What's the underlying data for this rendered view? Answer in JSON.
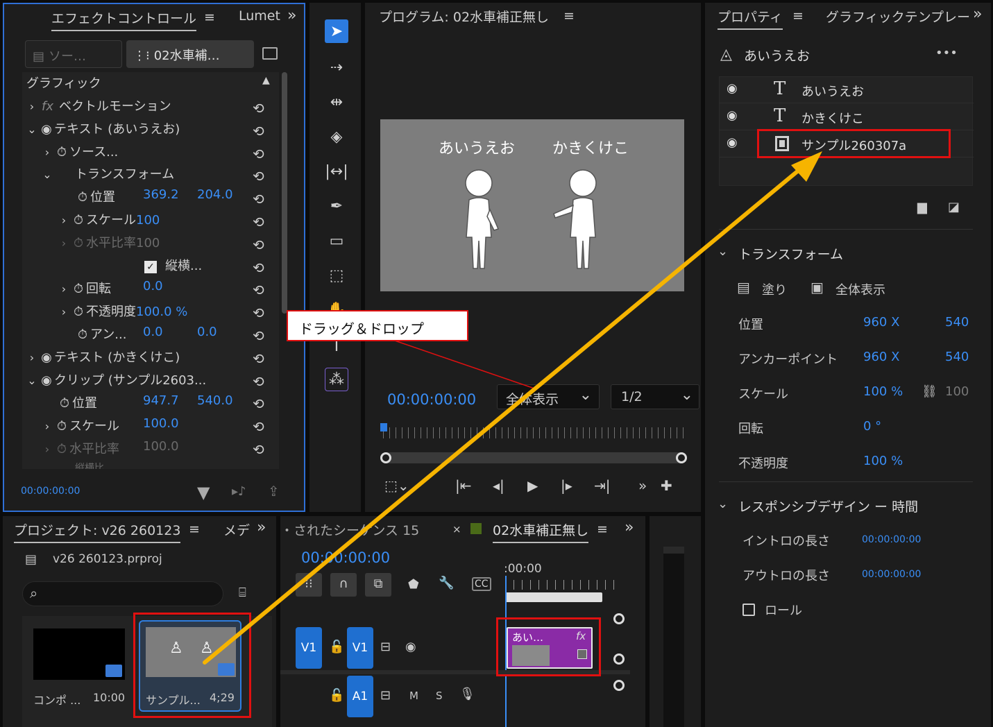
{
  "effect_controls": {
    "tab_title": "エフェクトコントロール",
    "tab_menu": "≡",
    "tab2": "Lumet",
    "overflow": "»",
    "source_btn": "ソー…",
    "clip_btn": "02水車補…",
    "time": "00:00:00:00",
    "rows": [
      {
        "label": "グラフィック"
      },
      {
        "label": "ベクトルモーション",
        "fx": "fx"
      },
      {
        "label": "テキスト (あいうえお)"
      },
      {
        "label": "ソース..."
      },
      {
        "label": "トランスフォーム"
      },
      {
        "label": "位置",
        "v1": "369.2",
        "v2": "204.0"
      },
      {
        "label": "スケール",
        "v1": "100"
      },
      {
        "label": "水平比率",
        "v1": "100"
      },
      {
        "label": "縦横..."
      },
      {
        "label": "回転",
        "v1": "0.0"
      },
      {
        "label": "不透明度",
        "v1": "100.0 %"
      },
      {
        "label": "アン...",
        "v1": "0.0",
        "v2": "0.0"
      },
      {
        "label": "テキスト (かきくけこ)"
      },
      {
        "label": "クリップ (サンプル2603..."
      },
      {
        "label": "位置",
        "v1": "947.7",
        "v2": "540.0"
      },
      {
        "label": "スケール",
        "v1": "100.0"
      },
      {
        "label": "水平比率",
        "v1": "100.0"
      },
      {
        "label": "縦横比"
      }
    ]
  },
  "program": {
    "title": "プログラム: 02水車補正無し",
    "menu": "≡",
    "text_a": "あいうえお",
    "text_b": "かきくけこ",
    "timecode": "00:00:00:00",
    "zoom": "全体表示",
    "resolution": "1/2",
    "playhead": 0.0
  },
  "callout": {
    "text": "ドラッグ＆ドロップ"
  },
  "properties": {
    "tab_title": "プロパティ",
    "tab_menu": "≡",
    "tab2": "グラフィックテンプレー",
    "overflow": "»",
    "heading": "あいうえお",
    "more": "•••",
    "layers": [
      {
        "type": "T",
        "name": "あいうえお"
      },
      {
        "type": "T",
        "name": "かきくけこ"
      },
      {
        "type": "clip",
        "name": "サンプル260307a"
      }
    ],
    "transform_title": "トランスフォーム",
    "fill": "塗り",
    "fit": "全体表示",
    "position_label": "位置",
    "position_x": "960 X",
    "position_y": "540",
    "anchor_label": "アンカーポイント",
    "anchor_x": "960 X",
    "anchor_y": "540",
    "scale_label": "スケール",
    "scale_value": "100 %",
    "scale_linked": "100",
    "rotation_label": "回転",
    "rotation_value": "0 °",
    "opacity_label": "不透明度",
    "opacity_value": "100 %",
    "responsive_title": "レスポンシブデザイン ー 時間",
    "intro_label": "イントロの長さ",
    "intro_value": "00:00:00:00",
    "outro_label": "アウトロの長さ",
    "outro_value": "00:00:00:00",
    "roll_label": "ロール"
  },
  "project": {
    "title": "プロジェクト: v26 260123",
    "menu": "≡",
    "tab2": "メデ",
    "overflow": "»",
    "file": "v26 260123.prproj",
    "items": [
      {
        "name": "コンポ ...",
        "duration": "10:00"
      },
      {
        "name": "サンプル...",
        "duration": "4;29"
      }
    ]
  },
  "timeline": {
    "tab_left": "・されたシーケンス 15",
    "close": "×",
    "title": "02水車補正無し",
    "menu": "≡",
    "overflow": "»",
    "timecode": "00:00:00:00",
    "ruler": ":00:00",
    "track_v1": "V1",
    "track_v1b": "V1",
    "track_a1": "A1",
    "m": "M",
    "s": "S",
    "clip_label": "あい…",
    "clip_fx": "fx"
  },
  "colors": {
    "accent": "#3a8ef6",
    "clip": "#8a2ba6",
    "arrow": "#f6b400",
    "highlight": "#e01010"
  }
}
